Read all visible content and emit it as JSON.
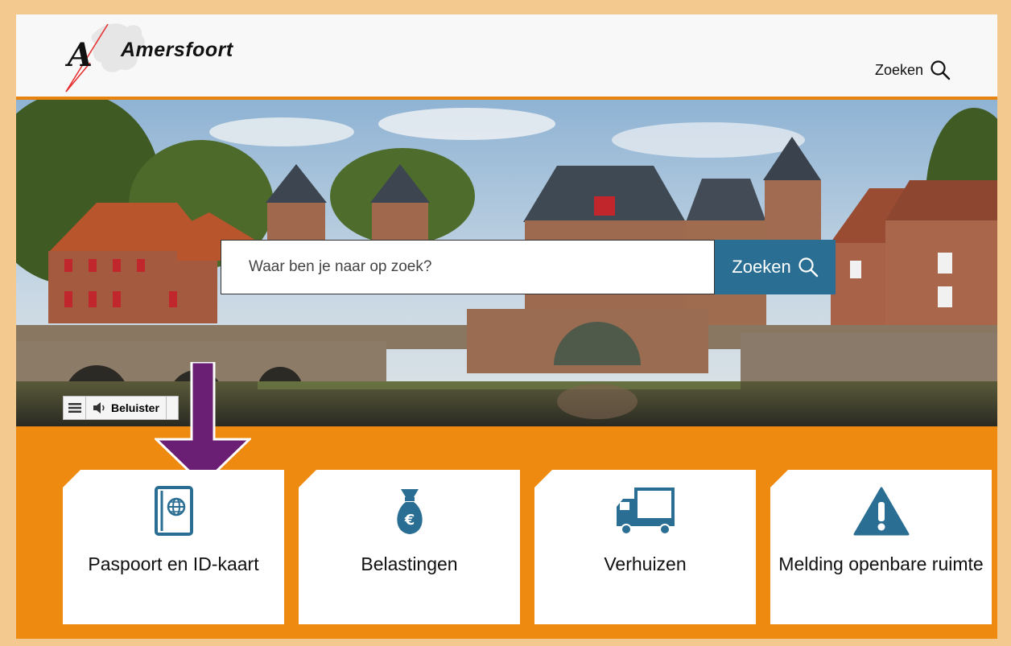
{
  "brand": {
    "logo_text": "Amersfoort",
    "accent": "#ef8a10",
    "primary": "#2a6f93",
    "annotation": "#6b1f74"
  },
  "header": {
    "search_label": "Zoeken",
    "search_icon": "search-icon"
  },
  "hero": {
    "search": {
      "placeholder": "Waar ben je naar op zoek?",
      "button_label": "Zoeken"
    },
    "readspeaker": {
      "menu_icon": "hamburger-icon",
      "listen_label": "Beluister",
      "speaker_icon": "speaker-icon"
    }
  },
  "cards": [
    {
      "label": "Paspoort en ID-kaart",
      "icon": "passport-icon"
    },
    {
      "label": "Belastingen",
      "icon": "money-bag-icon"
    },
    {
      "label": "Verhuizen",
      "icon": "truck-icon"
    },
    {
      "label": "Melding openbare ruimte",
      "icon": "warning-icon"
    }
  ]
}
